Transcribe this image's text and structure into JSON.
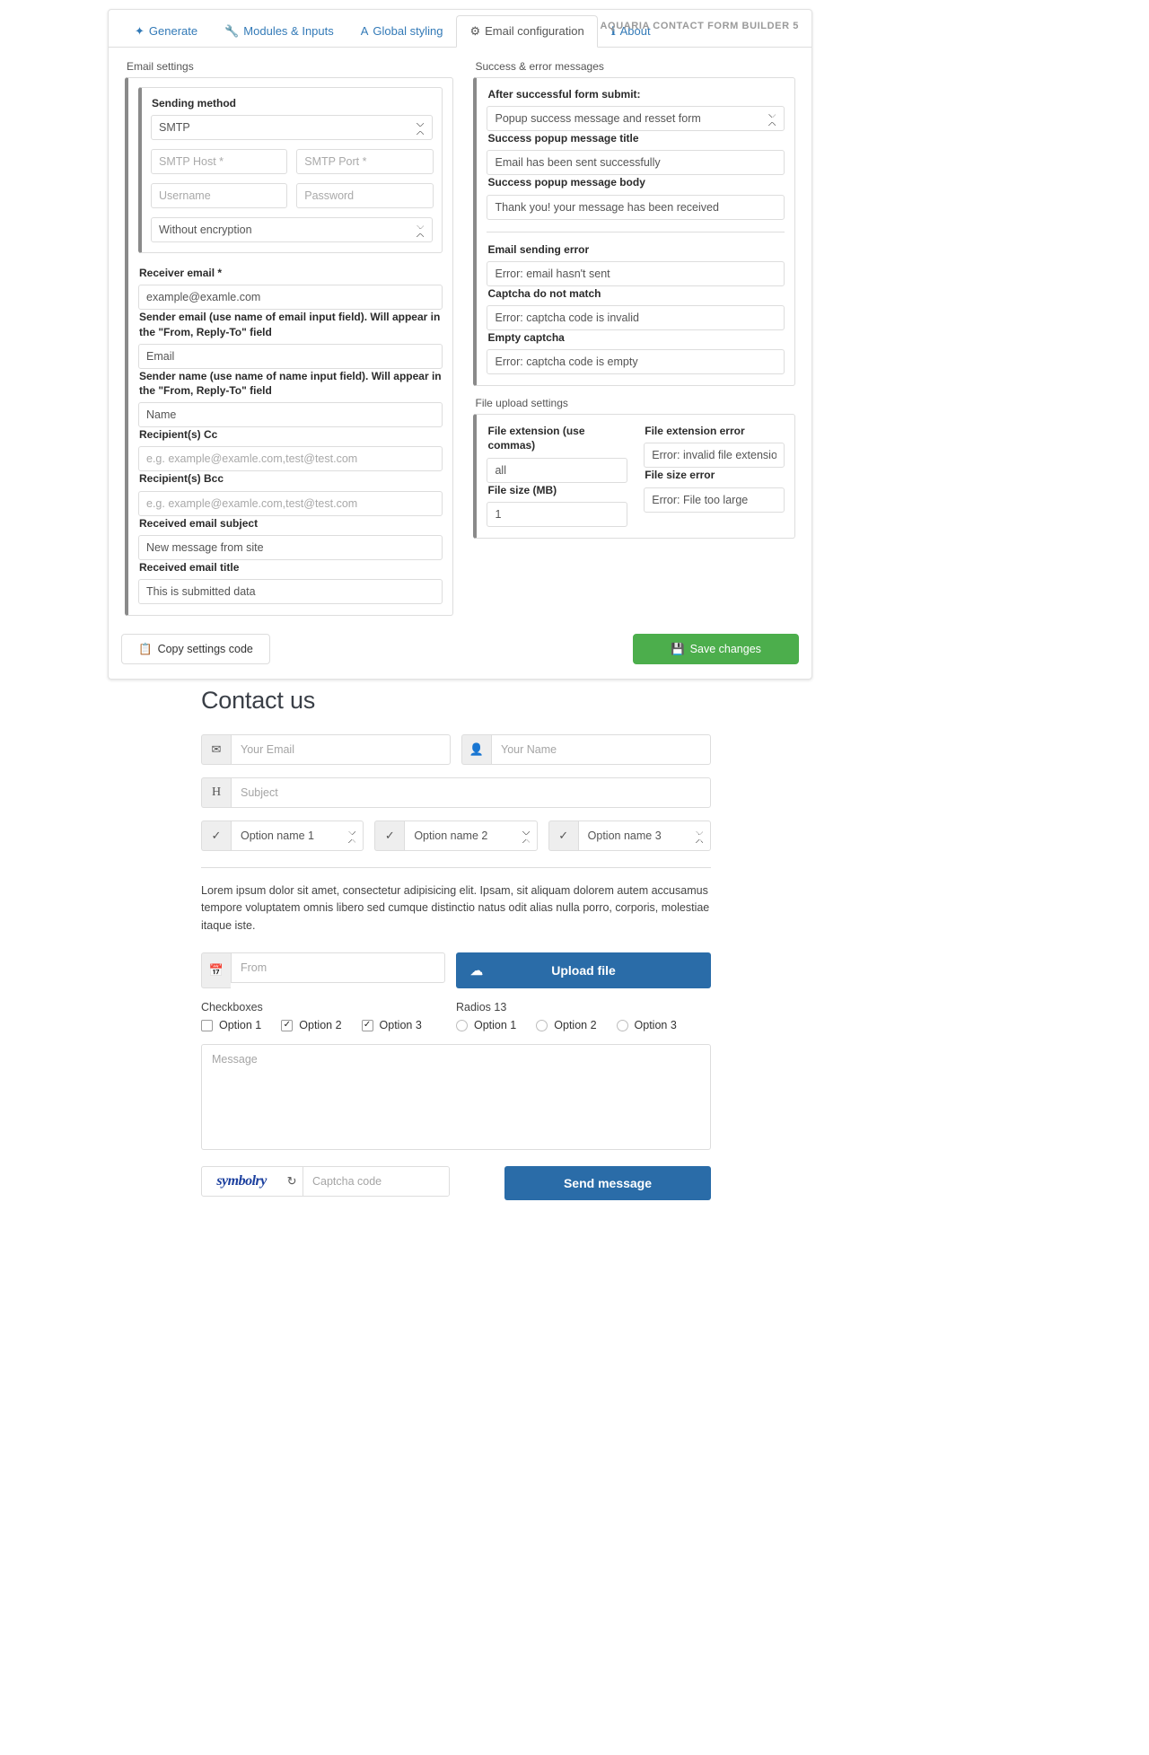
{
  "app": {
    "brand": "AQUARIA CONTACT FORM BUILDER 5",
    "tabs": [
      {
        "label": "Generate",
        "icon": "feather-icon",
        "active": false
      },
      {
        "label": "Modules & Inputs",
        "icon": "wrench-icon",
        "active": false
      },
      {
        "label": "Global styling",
        "icon": "font-icon",
        "active": false
      },
      {
        "label": "Email configuration",
        "icon": "gear-icon",
        "active": true
      },
      {
        "label": "About",
        "icon": "info-icon",
        "active": false
      }
    ]
  },
  "email_settings": {
    "group_title": "Email settings",
    "sending_method_label": "Sending method",
    "sending_method_value": "SMTP",
    "smtp_host_placeholder": "SMTP Host *",
    "smtp_port_placeholder": "SMTP Port *",
    "username_placeholder": "Username",
    "password_placeholder": "Password",
    "encryption_value": "Without encryption",
    "receiver_email_label": "Receiver email *",
    "receiver_email_value": "example@examle.com",
    "sender_email_label": "Sender email (use name of email input field). Will appear in the \"From, Reply-To\" field",
    "sender_email_value": "Email",
    "sender_name_label": "Sender name (use name of name input field). Will appear in the \"From, Reply-To\" field",
    "sender_name_value": "Name",
    "cc_label": "Recipient(s) Cc",
    "cc_placeholder": "e.g. example@examle.com,test@test.com",
    "bcc_label": "Recipient(s) Bcc",
    "bcc_placeholder": "e.g. example@examle.com,test@test.com",
    "subject_label": "Received email subject",
    "subject_value": "New message from site",
    "title_label": "Received email title",
    "title_value": "This is submitted data"
  },
  "messages": {
    "group_title": "Success & error messages",
    "after_submit_label": "After successful form submit:",
    "after_submit_value": "Popup success message and resset form",
    "success_title_label": "Success popup message title",
    "success_title_value": "Email has been sent successfully",
    "success_body_label": "Success popup message body",
    "success_body_value": "Thank you! your message has been received",
    "sending_error_label": "Email sending error",
    "sending_error_value": "Error: email hasn't sent",
    "captcha_mismatch_label": "Captcha do not match",
    "captcha_mismatch_value": "Error: captcha code is invalid",
    "captcha_empty_label": "Empty captcha",
    "captcha_empty_value": "Error: captcha code is empty"
  },
  "file_upload": {
    "group_title": "File upload settings",
    "extension_label": "File extension (use commas)",
    "extension_value": "all",
    "size_label": "File size (MB)",
    "size_value": "1",
    "extension_error_label": "File extension error",
    "extension_error_value": "Error: invalid file extension",
    "size_error_label": "File size error",
    "size_error_value": "Error: File too large"
  },
  "footer": {
    "copy_label": "Copy settings code",
    "copy_icon": "copy-icon",
    "save_label": "Save changes",
    "save_icon": "floppy-disk-icon",
    "save_color": "#4cae4c"
  },
  "preview": {
    "heading": "Contact us",
    "email_placeholder": "Your Email",
    "email_icon": "envelope-icon",
    "name_placeholder": "Your Name",
    "name_icon": "user-icon",
    "subject_placeholder": "Subject",
    "subject_icon": "heading-icon",
    "selects": [
      {
        "value": "Option name 1",
        "icon": "check-icon"
      },
      {
        "value": "Option name 2",
        "icon": "check-icon"
      },
      {
        "value": "Option name 3",
        "icon": "check-icon"
      }
    ],
    "paragraph": "Lorem ipsum dolor sit amet, consectetur adipisicing elit. Ipsam, sit aliquam dolorem autem accusamus tempore voluptatem omnis libero sed cumque distinctio natus odit alias nulla porro, corporis, molestiae itaque iste.",
    "date_placeholder": "From",
    "date_icon": "calendar-icon",
    "upload_label": "Upload file",
    "upload_icon": "cloud-upload-icon",
    "upload_color": "#2a6ca8",
    "checkboxes_title": "Checkboxes",
    "checkboxes": [
      {
        "label": "Option 1",
        "checked": false
      },
      {
        "label": "Option 2",
        "checked": true
      },
      {
        "label": "Option 3",
        "checked": true
      }
    ],
    "radios_title": "Radios 13",
    "radios": [
      {
        "label": "Option 1",
        "checked": false
      },
      {
        "label": "Option 2",
        "checked": false
      },
      {
        "label": "Option 3",
        "checked": false
      }
    ],
    "message_placeholder": "Message",
    "captcha_text": "symbolry",
    "captcha_reload_icon": "refresh-icon",
    "captcha_placeholder": "Captcha code",
    "send_label": "Send message",
    "send_color": "#2a6ca8"
  }
}
